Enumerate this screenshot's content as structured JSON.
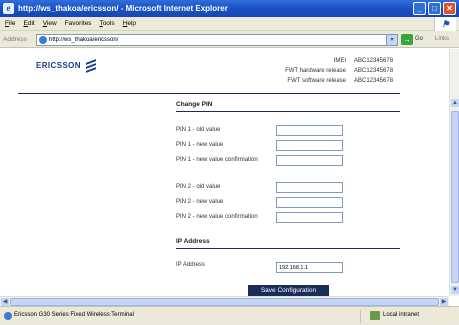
{
  "window": {
    "title": "http://ws_thakoa/ericsson/ - Microsoft Internet Explorer",
    "minimize": "_",
    "maximize": "□",
    "close": "✕"
  },
  "menubar": {
    "items": [
      {
        "accel": "F",
        "rest": "ile"
      },
      {
        "accel": "E",
        "rest": "dit"
      },
      {
        "accel": "V",
        "rest": "iew"
      },
      {
        "accel": "",
        "rest": "Favorites"
      },
      {
        "accel": "T",
        "rest": "ools"
      },
      {
        "accel": "H",
        "rest": "elp"
      }
    ]
  },
  "address": {
    "label": "Address",
    "url": "http://ws_thakoa/ericsson/",
    "go": "Go",
    "links": "Links"
  },
  "brand": {
    "name": "ERICSSON",
    "color": "#1a3a8a"
  },
  "device_info": [
    {
      "label": "IMEI",
      "value": "ABC12345678"
    },
    {
      "label": "FWT hardware release",
      "value": "ABC12345678"
    },
    {
      "label": "FWT software release",
      "value": "ABC12345678"
    }
  ],
  "change_pin": {
    "title": "Change PIN",
    "fields": [
      {
        "label": "PIN 1 - old value",
        "value": ""
      },
      {
        "label": "PIN 1 - new value",
        "value": ""
      },
      {
        "label": "PIN 1 - new value confirmation",
        "value": ""
      },
      {
        "label": "PIN 2 - old value",
        "value": ""
      },
      {
        "label": "PIN 2 - new value",
        "value": ""
      },
      {
        "label": "PIN 2 - new value confirmation",
        "value": ""
      }
    ]
  },
  "ip_address": {
    "title": "IP Address",
    "label": "IP Address",
    "value": "192.168.1.1"
  },
  "save_button": "Save Configuration",
  "status": {
    "text": "Ericsson G30 Series Fixed Wireless Terminal",
    "zone": "Local intranet"
  },
  "colors": {
    "accent": "#1a2d5a",
    "titlebar": "#1b50c4"
  }
}
